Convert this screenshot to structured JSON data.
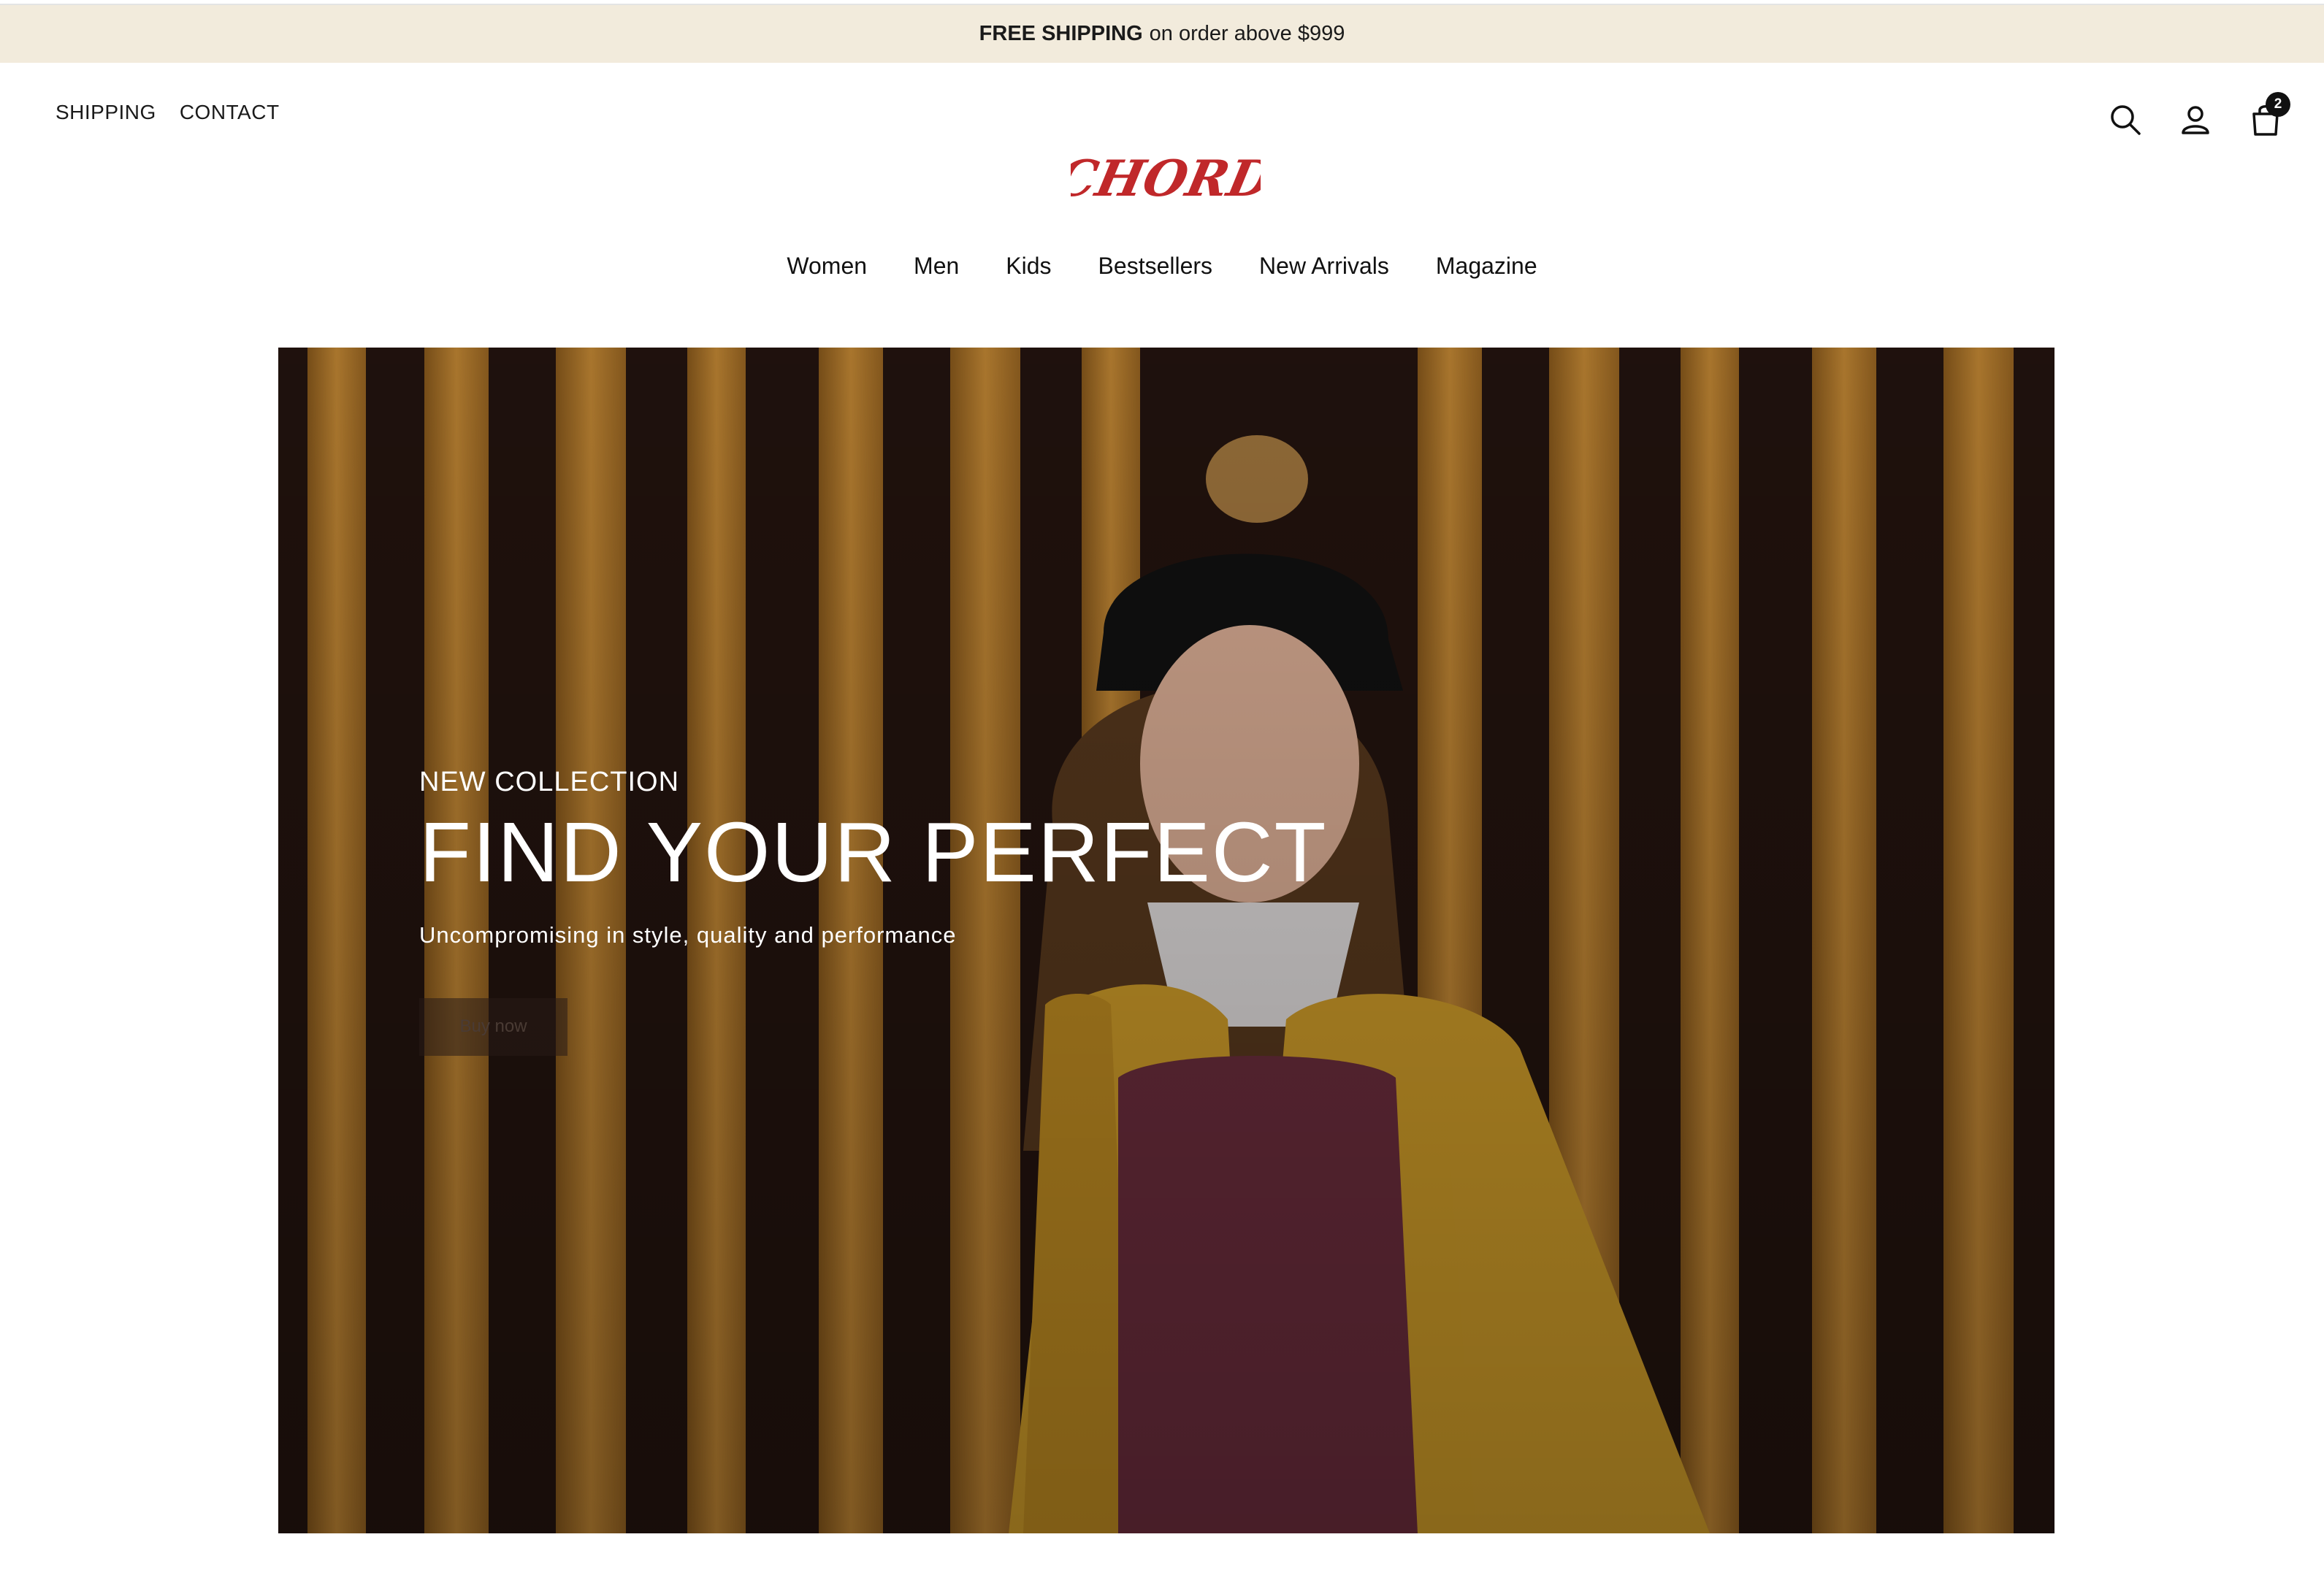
{
  "promo": {
    "bold": "FREE SHIPPING",
    "rest": "on order above $999"
  },
  "util_links": [
    "SHIPPING",
    "CONTACT"
  ],
  "logo": {
    "text": "CHORD",
    "color": "#c0282a"
  },
  "header_icons": {
    "search": "search-icon",
    "account": "user-icon",
    "cart": "shopping-bag-icon"
  },
  "cart_count": "2",
  "nav": [
    "Women",
    "Men",
    "Kids",
    "Bestsellers",
    "New Arrivals",
    "Magazine"
  ],
  "hero": {
    "eyebrow": "NEW COLLECTION",
    "headline": "FIND YOUR PERFECT",
    "subline": "Uncompromising in style, quality and performance",
    "button": "Buy now"
  },
  "colors": {
    "promo_bg": "#f2ebdc",
    "accent": "#c0282a",
    "coat": "#d4a02a",
    "sweater": "#6e2e3e"
  }
}
